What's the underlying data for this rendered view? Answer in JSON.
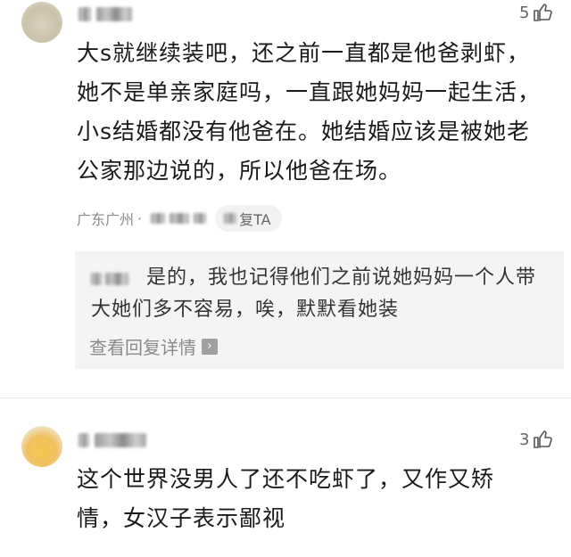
{
  "comment1": {
    "likes": "5",
    "text": "大s就继续装吧，还之前一直都是他爸剥虾，她不是单亲家庭吗，一直跟她妈妈一起生活，小s结婚都没有他爸在。她结婚应该是被她老公家那边说的，所以他爸在场。",
    "location": "广东广州",
    "separator": "·",
    "reply_label": "复TA"
  },
  "reply": {
    "text": "是的，我也记得他们之前说她妈妈一个人带大她们多不容易，唉，默默看她装",
    "view_more": "查看回复详情",
    "arrow": "›"
  },
  "comment2": {
    "likes": "3",
    "text": "这个世界没男人了还不吃虾了，又作又矫情，女汉子表示鄙视"
  },
  "icons": {
    "like": "thumbs-up-icon",
    "arrow": "chevron-right-icon"
  },
  "colors": {
    "text": "#1a1a1a",
    "meta": "#8a8a8a",
    "reply_bg": "#f4f4f4"
  }
}
